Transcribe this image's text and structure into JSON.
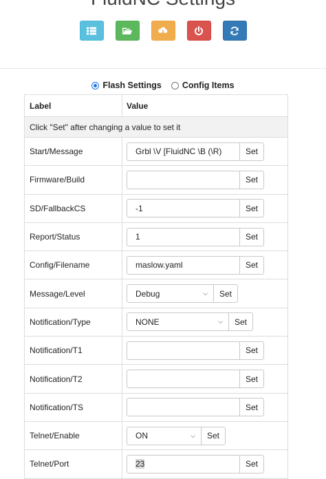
{
  "page": {
    "title": "FluidNC Settings"
  },
  "toolbar": {
    "buttons": [
      {
        "icon": "list-icon",
        "color": "#5bc0de"
      },
      {
        "icon": "folder-open-icon",
        "color": "#5cb85c"
      },
      {
        "icon": "cloud-download-icon",
        "color": "#f0ad4e"
      },
      {
        "icon": "power-icon",
        "color": "#d9534f"
      },
      {
        "icon": "refresh-icon",
        "color": "#337ab7"
      }
    ]
  },
  "mode": {
    "flash_label": "Flash Settings",
    "config_label": "Config Items",
    "selected": "flash"
  },
  "table": {
    "header_label": "Label",
    "header_value": "Value",
    "info": "Click \"Set\" after changing a value to set it",
    "set_label": "Set",
    "rows": [
      {
        "label": "Start/Message",
        "value": "Grbl \\V [FluidNC \\B (\\R)",
        "type": "text"
      },
      {
        "label": "Firmware/Build",
        "value": "",
        "type": "text"
      },
      {
        "label": "SD/FallbackCS",
        "value": "-1",
        "type": "text"
      },
      {
        "label": "Report/Status",
        "value": "1",
        "type": "text"
      },
      {
        "label": "Config/Filename",
        "value": "maslow.yaml",
        "type": "text"
      },
      {
        "label": "Message/Level",
        "value": "Debug",
        "type": "select"
      },
      {
        "label": "Notification/Type",
        "value": "NONE",
        "type": "select"
      },
      {
        "label": "Notification/T1",
        "value": "",
        "type": "text"
      },
      {
        "label": "Notification/T2",
        "value": "",
        "type": "text"
      },
      {
        "label": "Notification/TS",
        "value": "",
        "type": "text"
      },
      {
        "label": "Telnet/Enable",
        "value": "ON",
        "type": "select"
      },
      {
        "label": "Telnet/Port",
        "value": "23",
        "type": "text"
      }
    ]
  }
}
